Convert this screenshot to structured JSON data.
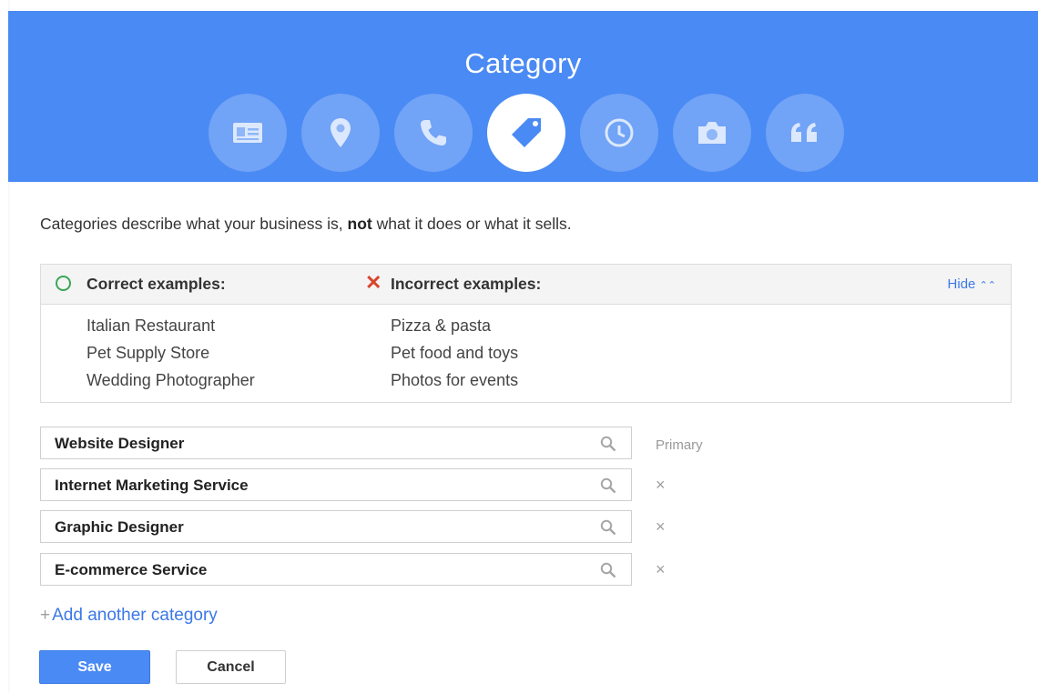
{
  "header": {
    "title": "Category",
    "steps": [
      {
        "icon": "contact-card-icon",
        "active": false
      },
      {
        "icon": "location-pin-icon",
        "active": false
      },
      {
        "icon": "phone-icon",
        "active": false
      },
      {
        "icon": "tag-icon",
        "active": true
      },
      {
        "icon": "clock-icon",
        "active": false
      },
      {
        "icon": "camera-icon",
        "active": false
      },
      {
        "icon": "quote-icon",
        "active": false
      }
    ],
    "bg_color": "#4a8af4"
  },
  "description": {
    "before": "Categories describe what your business is, ",
    "emphasis": "not",
    "after": " what it does or what it sells."
  },
  "examples": {
    "correct_label": "Correct examples:",
    "incorrect_label": "Incorrect examples:",
    "hide_label": "Hide",
    "correct": [
      "Italian Restaurant",
      "Pet Supply Store",
      "Wedding Photographer"
    ],
    "incorrect": [
      "Pizza & pasta",
      "Pet food and toys",
      "Photos for events"
    ],
    "correct_color": "#3aa757",
    "incorrect_color": "#d9452c"
  },
  "categories": [
    {
      "value": "Website Designer",
      "side": "Primary"
    },
    {
      "value": "Internet Marketing Service",
      "side": "×"
    },
    {
      "value": "Graphic Designer",
      "side": "×"
    },
    {
      "value": "E-commerce Service",
      "side": "×"
    }
  ],
  "add_category": {
    "plus": "+",
    "label": "Add another category"
  },
  "actions": {
    "save_label": "Save",
    "cancel_label": "Cancel"
  },
  "link_color": "#3b78e7"
}
